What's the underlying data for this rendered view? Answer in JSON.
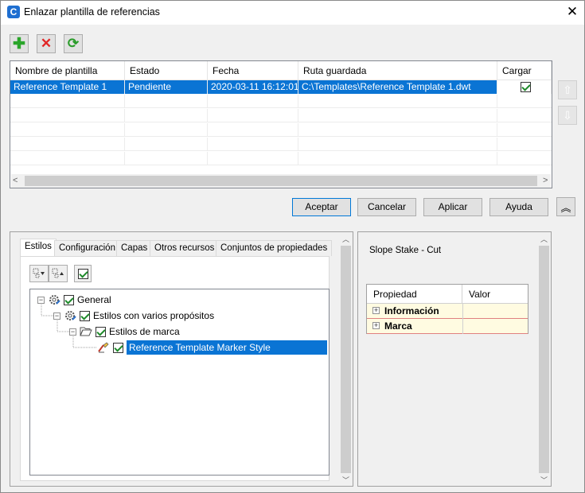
{
  "window": {
    "title": "Enlazar plantilla de referencias",
    "app_icon_letter": "C",
    "close_glyph": "✕"
  },
  "toolbar": {
    "add_glyph": "✚",
    "delete_glyph": "✕",
    "refresh_glyph": "⟳"
  },
  "grid": {
    "columns": [
      "Nombre de plantilla",
      "Estado",
      "Fecha",
      "Ruta guardada",
      "Cargar"
    ],
    "rows": [
      {
        "name": "Reference Template 1",
        "status": "Pendiente",
        "date": "2020-03-11 16:12:01",
        "path": "C:\\Templates\\Reference Template 1.dwt",
        "load": true
      }
    ],
    "scroll_left_glyph": "<",
    "scroll_right_glyph": ">"
  },
  "side": {
    "up_glyph": "⇧",
    "down_glyph": "⇩"
  },
  "buttons": {
    "accept": "Aceptar",
    "cancel": "Cancelar",
    "apply": "Aplicar",
    "help": "Ayuda",
    "collapse_glyph": "︽"
  },
  "tabs": [
    "Estilos",
    "Configuración",
    "Capas",
    "Otros recursos",
    "Conjuntos de propiedades"
  ],
  "tree": {
    "nodes": [
      {
        "label": "General",
        "icon": "gear-icon",
        "checked": true,
        "expanded": true
      },
      {
        "label": "Estilos con varios propósitos",
        "icon": "gear-icon",
        "checked": true,
        "expanded": true
      },
      {
        "label": "Estilos de marca",
        "icon": "folder-open-icon",
        "checked": true,
        "expanded": true
      },
      {
        "label": "Reference Template Marker Style",
        "icon": "marker-style-icon",
        "checked": true,
        "selected": true
      }
    ]
  },
  "right_panel": {
    "style_name": "Slope Stake - Cut",
    "prop_header": "Propiedad",
    "value_header": "Valor",
    "props": [
      {
        "label": "Información",
        "value": ""
      },
      {
        "label": "Marca",
        "value": ""
      }
    ]
  },
  "colors": {
    "selection": "#0a74d4",
    "add_green": "#2aa52a",
    "delete_red": "#e12525",
    "refresh_green": "#2a9c2a",
    "prop_row_bg": "#fffbe1"
  }
}
